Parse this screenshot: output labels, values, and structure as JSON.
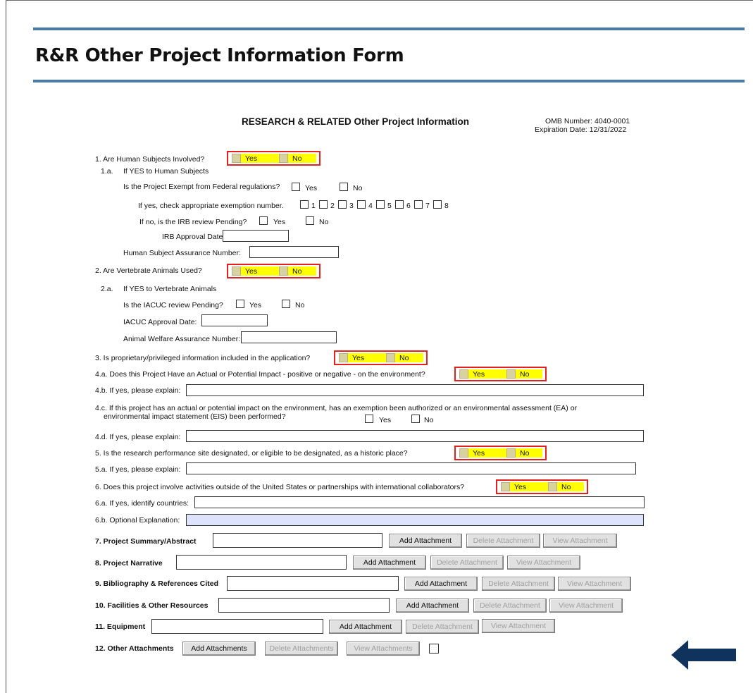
{
  "page": {
    "title": "R&R Other Project Information Form"
  },
  "form": {
    "heading": "RESEARCH & RELATED Other Project Information",
    "omb_number": "OMB Number: 4040-0001",
    "expiration": "Expiration Date: 12/31/2022",
    "yes": "Yes",
    "no": "No",
    "q1": "1. Are Human Subjects Involved?",
    "q1a_num": "1.a.",
    "q1a": "If YES to Human Subjects",
    "q1a_exempt": "Is the Project Exempt from Federal regulations?",
    "q1a_exemption_num": "If yes, check appropriate exemption number.",
    "exemption_numbers": [
      "1",
      "2",
      "3",
      "4",
      "5",
      "6",
      "7",
      "8"
    ],
    "q1a_irb_pending": "If no, is the IRB review Pending?",
    "q1a_irb_date": "IRB Approval Date:",
    "q1a_assurance": "Human Subject Assurance Number:",
    "q2": "2. Are Vertebrate Animals Used?",
    "q2a_num": "2.a.",
    "q2a": "If YES to Vertebrate Animals",
    "q2a_iacuc_pending": "Is the IACUC review Pending?",
    "q2a_iacuc_date": "IACUC Approval Date:",
    "q2a_welfare": "Animal Welfare Assurance Number:",
    "q3": "3. Is proprietary/privileged information included in the application?",
    "q4a": "4.a. Does this Project Have an Actual or Potential Impact - positive or negative - on the environment?",
    "q4b": "4.b. If yes, please explain:",
    "q4c_line1": "4.c. If this project has an actual or potential impact on the environment, has an exemption been authorized or an environmental assessment (EA) or",
    "q4c_line2": "environmental impact statement (EIS) been performed?",
    "q4d": "4.d. If yes, please explain:",
    "q5": "5. Is the research performance site designated, or eligible to be designated, as a historic place?",
    "q5a": "5.a. If yes, please explain:",
    "q6": "6.  Does this project involve activities outside of the United States or partnerships with international collaborators?",
    "q6a": "6.a. If yes, identify countries:",
    "q6b": "6.b. Optional Explanation:",
    "q7": "7. Project Summary/Abstract",
    "q8": "8. Project Narrative",
    "q9": "9. Bibliography & References Cited",
    "q10": "10. Facilities & Other Resources",
    "q11": "11. Equipment",
    "q12": "12. Other Attachments",
    "add_attachment": "Add Attachment",
    "delete_attachment": "Delete Attachment",
    "view_attachment": "View Attachment",
    "add_attachments": "Add Attachments",
    "delete_attachments": "Delete Attachments",
    "view_attachments": "View  Attachments"
  },
  "colors": {
    "rule": "#4a7aa8",
    "highlight": "#ffff00",
    "highlight_border": "#e4211f",
    "arrow": "#10335e",
    "optional_field": "#dde3fb"
  },
  "icons": {
    "back_arrow": "left-arrow-icon"
  }
}
